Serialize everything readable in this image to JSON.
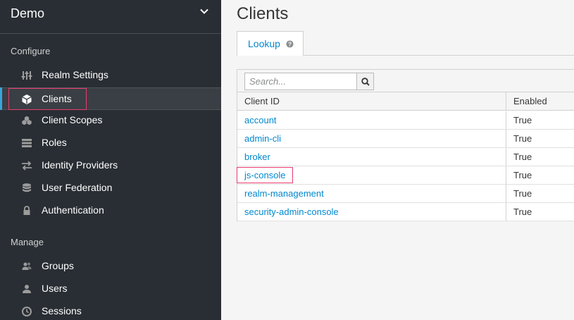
{
  "sidebar": {
    "realm_name": "Demo",
    "sections": {
      "configure": "Configure",
      "manage": "Manage"
    },
    "configure_items": [
      {
        "label": "Realm Settings",
        "icon": "sliders-icon"
      },
      {
        "label": "Clients",
        "icon": "cube-icon",
        "active": true
      },
      {
        "label": "Client Scopes",
        "icon": "cubes-icon"
      },
      {
        "label": "Roles",
        "icon": "list-icon"
      },
      {
        "label": "Identity Providers",
        "icon": "exchange-icon"
      },
      {
        "label": "User Federation",
        "icon": "database-icon"
      },
      {
        "label": "Authentication",
        "icon": "lock-icon"
      }
    ],
    "manage_items": [
      {
        "label": "Groups",
        "icon": "users-group-icon"
      },
      {
        "label": "Users",
        "icon": "user-icon"
      },
      {
        "label": "Sessions",
        "icon": "clock-icon"
      }
    ]
  },
  "main": {
    "title": "Clients",
    "tabs": [
      {
        "label": "Lookup"
      }
    ],
    "search": {
      "placeholder": "Search..."
    },
    "table": {
      "columns": [
        "Client ID",
        "Enabled"
      ],
      "rows": [
        {
          "client_id": "account",
          "enabled": "True"
        },
        {
          "client_id": "admin-cli",
          "enabled": "True"
        },
        {
          "client_id": "broker",
          "enabled": "True"
        },
        {
          "client_id": "js-console",
          "enabled": "True"
        },
        {
          "client_id": "realm-management",
          "enabled": "True"
        },
        {
          "client_id": "security-admin-console",
          "enabled": "True"
        }
      ]
    }
  },
  "colors": {
    "sidebar_bg": "#292e34",
    "link": "#0088ce",
    "highlight": "#ec3b71",
    "active_accent": "#39a5dc"
  }
}
